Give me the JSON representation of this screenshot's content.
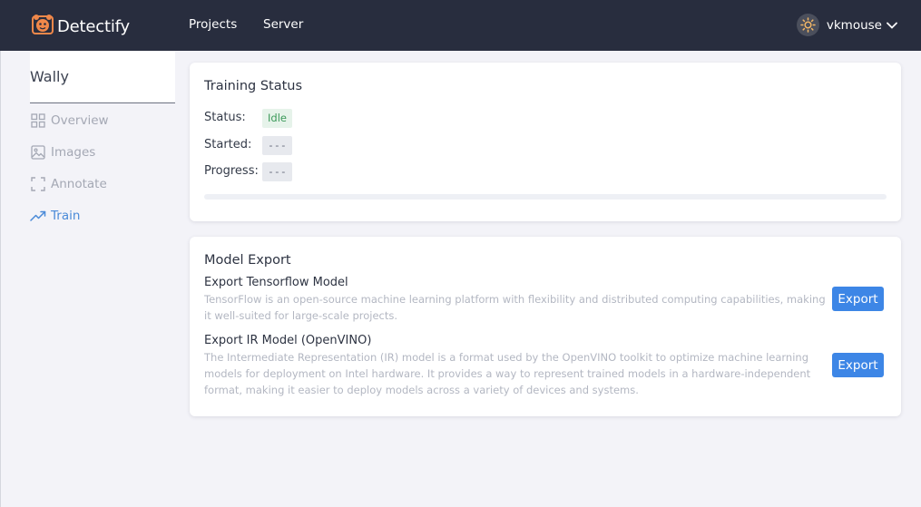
{
  "app": {
    "name": "Detectify"
  },
  "nav": {
    "links": [
      "Projects",
      "Server"
    ],
    "username": "vkmouse"
  },
  "sidebar": {
    "title": "Wally",
    "items": [
      {
        "label": "Overview",
        "icon": "grid-icon",
        "active": false
      },
      {
        "label": "Images",
        "icon": "image-icon",
        "active": false
      },
      {
        "label": "Annotate",
        "icon": "crop-frame-icon",
        "active": false
      },
      {
        "label": "Train",
        "icon": "trending-up-icon",
        "active": true
      }
    ]
  },
  "training": {
    "title": "Training Status",
    "status_label": "Status:",
    "status_value": "Idle",
    "started_label": "Started:",
    "started_value": "---",
    "progress_label": "Progress:",
    "progress_value": "---",
    "progress_fraction": 0
  },
  "export": {
    "title": "Model Export",
    "items": [
      {
        "title": "Export Tensorflow Model",
        "description": "TensorFlow is an open-source machine learning platform with flexibility and distributed computing capabilities, making it well-suited for large-scale projects.",
        "button": "Export"
      },
      {
        "title": "Export IR Model (OpenVINO)",
        "description": "The Intermediate Representation (IR) model is a format used by the OpenVINO toolkit to optimize machine learning models for deployment on Intel hardware. It provides a way to represent trained models in a hardware-independent format, making it easier to deploy models across a variety of devices and systems.",
        "button": "Export"
      }
    ]
  },
  "colors": {
    "navbar": "#282d3e",
    "accent": "#4a8ad8",
    "button": "#3d86e6",
    "idle_chip_bg": "#e6f3ea",
    "idle_chip_text": "#3c9a5a",
    "logo": "#f0884a"
  }
}
